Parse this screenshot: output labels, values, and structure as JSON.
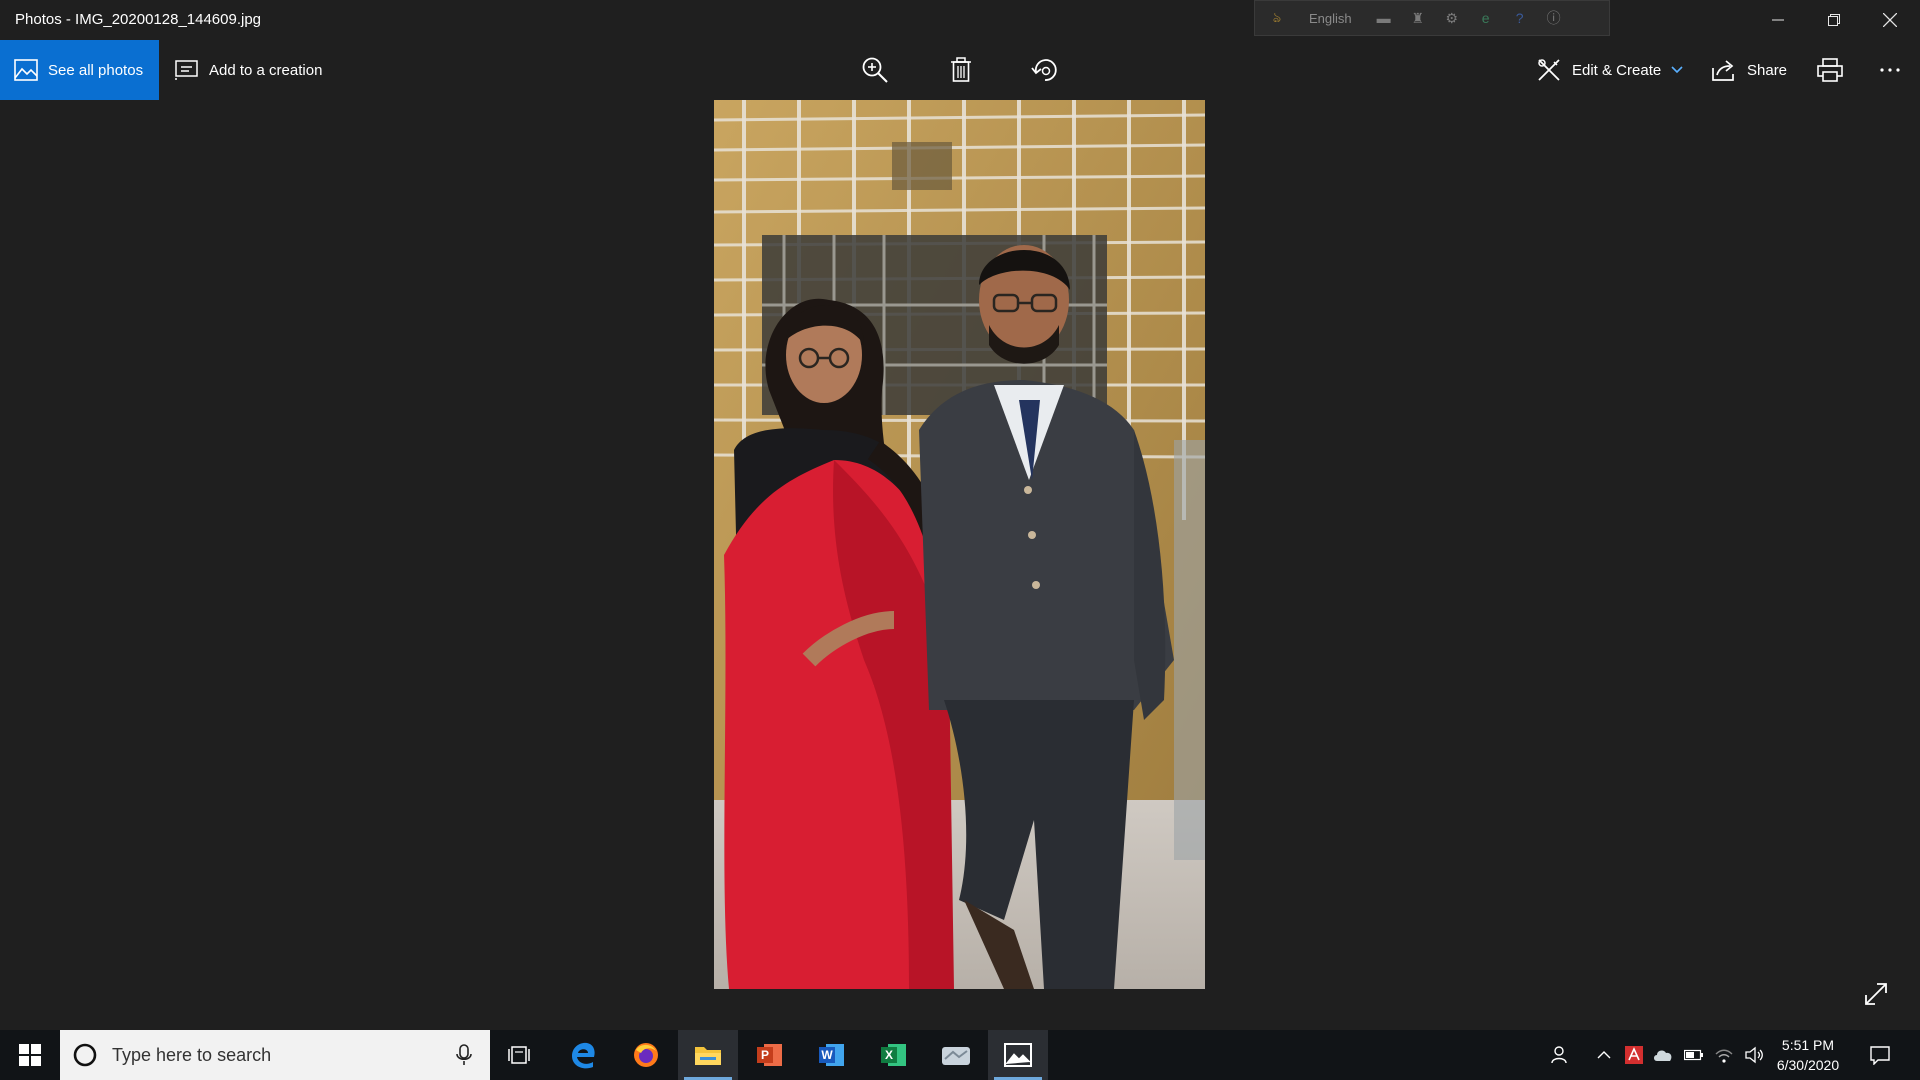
{
  "window": {
    "title": "Photos - IMG_20200128_144609.jpg"
  },
  "ime_bar": {
    "language": "English"
  },
  "toolbar": {
    "see_all_label": "See all photos",
    "add_creation_label": "Add to a creation",
    "edit_create_label": "Edit & Create",
    "share_label": "Share"
  },
  "taskbar": {
    "search_placeholder": "Type here to search",
    "time": "5:51 PM",
    "date": "6/30/2020"
  },
  "colors": {
    "accent": "#0a6fd1",
    "background": "#1f1f1f",
    "taskbar": "#111417"
  },
  "icons": {
    "zoom": "zoom-in-icon",
    "delete": "trash-icon",
    "rotate": "rotate-icon",
    "edit": "edit-create-icon",
    "share": "share-icon",
    "print": "print-icon",
    "more": "more-icon"
  }
}
